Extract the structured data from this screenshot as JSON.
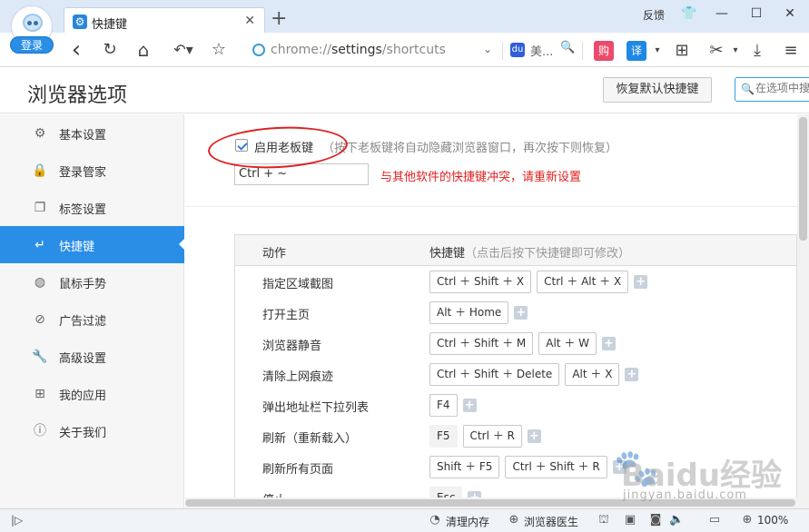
{
  "window": {
    "login_label": "登录",
    "tab_title": "快捷键",
    "tab_close": "✕",
    "new_tab": "+",
    "feedback": "反馈",
    "controls": {
      "skin": "👕",
      "minimize": "—",
      "maximize": "☐",
      "close": "✕"
    }
  },
  "toolbar": {
    "back": "‹",
    "refresh": "↻",
    "home": "⌂",
    "undo": "↶▾",
    "star": "☆",
    "address_prefix": "chrome://",
    "address_host": "settings",
    "address_path": "/shortcuts",
    "address_dropdown": "⌄",
    "search_engine": "美...",
    "search_logo": "du",
    "buy_label": "购",
    "translate_label": "译",
    "apps_icon": "⊞",
    "cut_icon": "✂",
    "download_icon": "⤓",
    "menu_icon": "≡"
  },
  "header": {
    "title": "浏览器选项",
    "restore_button": "恢复默认快捷键",
    "search_placeholder": "在选项中搜索"
  },
  "sidebar": {
    "active_index": 3,
    "items": [
      {
        "label": "基本设置",
        "icon": "⚙"
      },
      {
        "label": "登录管家",
        "icon": "🔒"
      },
      {
        "label": "标签设置",
        "icon": "❐"
      },
      {
        "label": "快捷键",
        "icon": "↵"
      },
      {
        "label": "鼠标手势",
        "icon": "◍"
      },
      {
        "label": "广告过滤",
        "icon": "⊘"
      },
      {
        "label": "高级设置",
        "icon": "🔧"
      },
      {
        "label": "我的应用",
        "icon": "⊞"
      },
      {
        "label": "关于我们",
        "icon": "ⓘ"
      }
    ]
  },
  "boss_key": {
    "checked": true,
    "label": "启用老板键",
    "hint": "（按下老板键将自动隐藏浏览器窗口，再次按下则恢复）",
    "value": "Ctrl + ~",
    "conflict_message": "与其他软件的快捷键冲突，请重新设置"
  },
  "shortcuts": {
    "col_action": "动作",
    "col_keys": "快捷键",
    "col_keys_hint": "（点击后按下快捷键即可修改）",
    "rows": [
      {
        "action": "指定区域截图",
        "keys": [
          "Ctrl ＋ Shift ＋ X",
          "Ctrl ＋ Alt ＋ X"
        ],
        "plain": [
          false,
          false
        ]
      },
      {
        "action": "打开主页",
        "keys": [
          "Alt ＋ Home"
        ],
        "plain": [
          false
        ]
      },
      {
        "action": "浏览器静音",
        "keys": [
          "Ctrl ＋ Shift ＋ M",
          "Alt ＋ W"
        ],
        "plain": [
          false,
          false
        ]
      },
      {
        "action": "清除上网痕迹",
        "keys": [
          "Ctrl ＋ Shift ＋ Delete",
          "Alt ＋ X"
        ],
        "plain": [
          false,
          false
        ]
      },
      {
        "action": "弹出地址栏下拉列表",
        "keys": [
          "F4"
        ],
        "plain": [
          false
        ]
      },
      {
        "action": "刷新（重新载入）",
        "keys": [
          "F5",
          "Ctrl ＋ R"
        ],
        "plain": [
          true,
          false
        ]
      },
      {
        "action": "刷新所有页面",
        "keys": [
          "Shift ＋ F5",
          "Ctrl ＋ Shift ＋ R"
        ],
        "plain": [
          false,
          false
        ]
      },
      {
        "action": "停止",
        "keys": [
          "Esc"
        ],
        "plain": [
          true
        ]
      }
    ]
  },
  "statusbar": {
    "expand": "|▷",
    "clean_memory": "清理内存",
    "doctor": "浏览器医生",
    "zoom": "100%"
  },
  "watermark": {
    "main": "Baidu经验",
    "sub": "jingyan.baidu.com"
  }
}
